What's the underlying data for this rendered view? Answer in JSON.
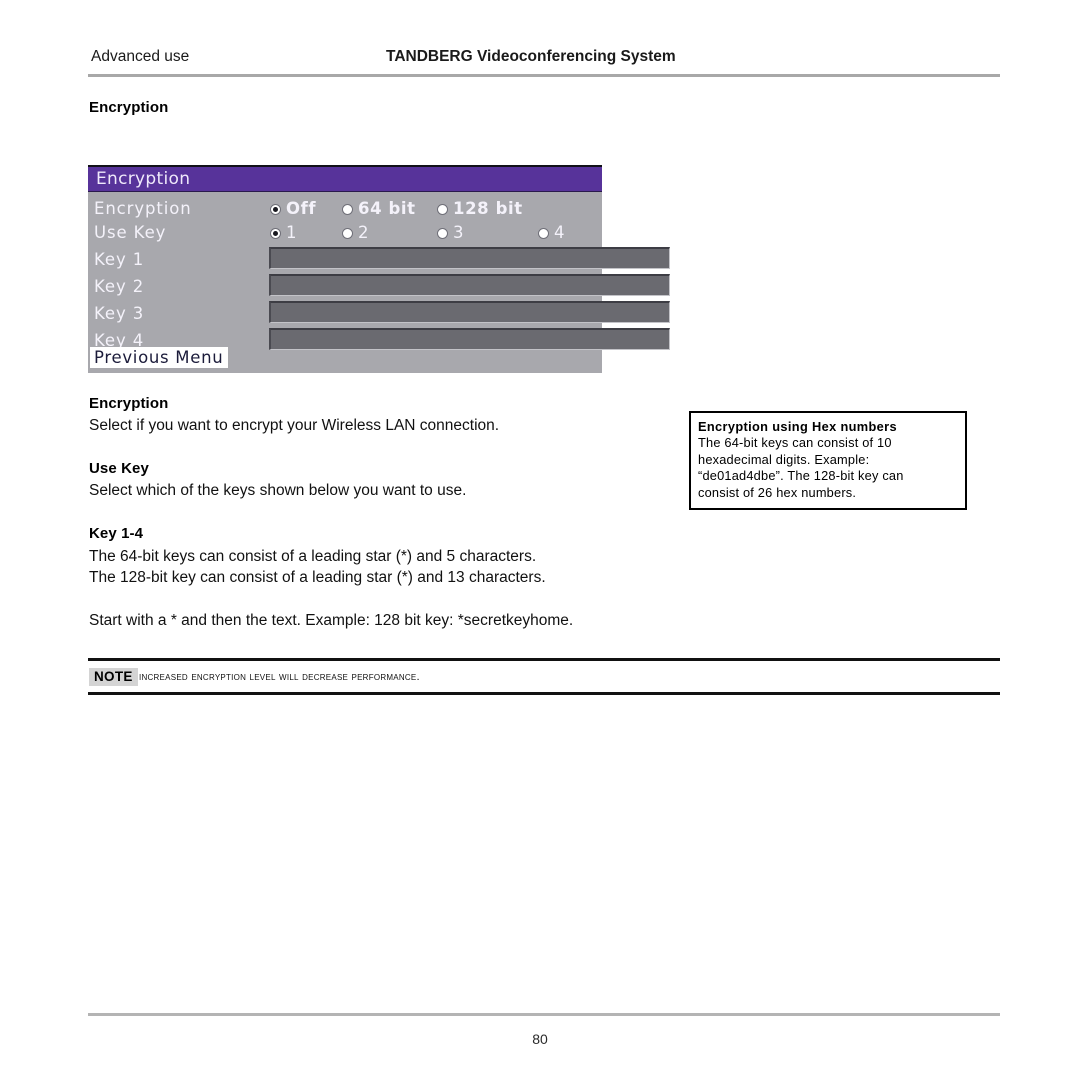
{
  "header": {
    "left": "Advanced use",
    "center": "TANDBERG Videoconferencing System"
  },
  "section_title": "Encryption",
  "device_panel": {
    "titlebar": "Encryption",
    "title_color": "#57339a",
    "panel_color": "#a8a8ad",
    "field_color": "#6a6a70",
    "rows": [
      {
        "label": "Encryption",
        "options": [
          {
            "label": "Off",
            "selected": true
          },
          {
            "label": "64 bit",
            "selected": false
          },
          {
            "label": "128 bit",
            "selected": false
          }
        ]
      },
      {
        "label": "Use Key",
        "options": [
          {
            "label": "1",
            "selected": true
          },
          {
            "label": "2",
            "selected": false
          },
          {
            "label": "3",
            "selected": false
          },
          {
            "label": "4",
            "selected": false
          }
        ]
      }
    ],
    "key_rows": [
      {
        "label": "Key 1",
        "value": ""
      },
      {
        "label": "Key 2",
        "value": ""
      },
      {
        "label": "Key 3",
        "value": ""
      },
      {
        "label": "Key 4",
        "value": ""
      }
    ],
    "previous_menu": "Previous Menu"
  },
  "body": {
    "encryption_heading": "Encryption",
    "encryption_text": "Select if you want to encrypt your Wireless LAN connection.",
    "usekey_heading": "Use Key",
    "usekey_text": "Select which of the keys shown below you want to use.",
    "key_heading": "Key 1-4",
    "key_line1": "The 64-bit keys can consist of a leading star (*) and 5 characters.",
    "key_line2": "The 128-bit key can consist of a leading star (*) and 13 characters.",
    "key_line3": "Start with a * and then the text. Example: 128 bit key: *secretkeyhome."
  },
  "side_note": {
    "title": "Encryption using Hex numbers",
    "line1": "The 64-bit keys can consist of 10",
    "line2": "hexadecimal digits. Example:",
    "line3": "“de01ad4dbe”. The 128-bit key can",
    "line4": "consist of 26 hex numbers."
  },
  "note_callout": {
    "tag": "NOTE",
    "text": "Increased encryption level will decrease performance."
  },
  "footer": {
    "page_number": "80"
  }
}
